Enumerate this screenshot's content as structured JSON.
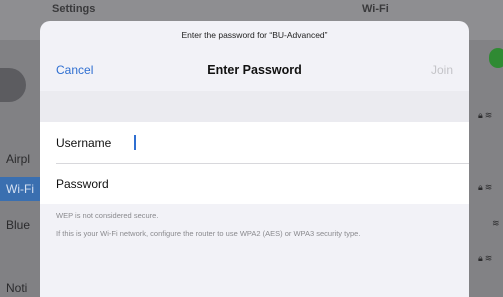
{
  "background": {
    "left_title": "Settings",
    "right_title": "Wi-Fi",
    "left_rows": [
      {
        "label": "Airpl",
        "highlighted": false
      },
      {
        "label": "Wi-Fi",
        "highlighted": true
      },
      {
        "label": "Blue",
        "highlighted": false
      },
      {
        "label": "Noti",
        "highlighted": false
      }
    ],
    "toggle_color": "#2f8a33",
    "accent": "#3a6fb0"
  },
  "dialog": {
    "prompt": "Enter the password for “BU-Advanced”",
    "cancel_label": "Cancel",
    "title": "Enter Password",
    "join_label": "Join",
    "username_label": "Username",
    "username_value": "",
    "password_label": "Password",
    "password_value": "",
    "warning": "WEP is not considered secure.",
    "advice": "If this is your Wi-Fi network, configure the router to use WPA2 (AES) or WPA3 security type.",
    "accent": "#2f6fd1"
  }
}
